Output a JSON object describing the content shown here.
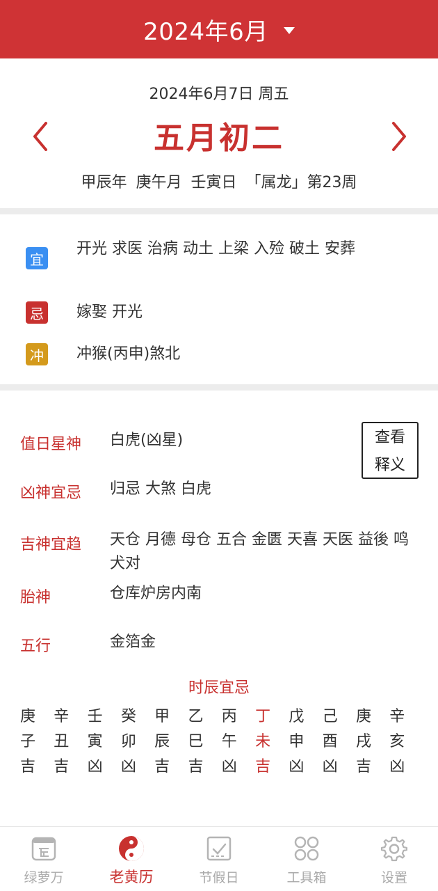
{
  "header": {
    "title": "2024年6月",
    "dropdown_icon": "caret-down-icon"
  },
  "date": {
    "solar": "2024年6月7日 周五",
    "lunar": "五月初二",
    "ganzhi": "甲辰年  庚午月  壬寅日  「属龙」第23周",
    "prev_icon": "chevron-left-icon",
    "next_icon": "chevron-right-icon"
  },
  "yiji": {
    "yi": {
      "badge": "宜",
      "color": "#3a8ff2",
      "text": "开光 求医 治病 动土 上梁 入殓 破土 安葬"
    },
    "ji": {
      "badge": "忌",
      "color": "#c8312f",
      "text": "嫁娶 开光"
    },
    "chong": {
      "badge": "冲",
      "color": "#d49a1c",
      "text": "冲猴(丙申)煞北"
    }
  },
  "details": {
    "explain_button": "查看释义",
    "rows": [
      {
        "label": "值日星神",
        "value": "白虎(凶星)"
      },
      {
        "label": "凶神宜忌",
        "value": "归忌 大煞 白虎"
      },
      {
        "label": "吉神宜趋",
        "value": "天仓 月德 母仓 五合 金匮 天喜 天医 益後 鸣犬对"
      },
      {
        "label": "胎神",
        "value": "仓库炉房内南"
      },
      {
        "label": "五行",
        "value": "金箔金"
      }
    ]
  },
  "hours": {
    "title": "时辰宜忌",
    "current_index": 7,
    "columns": [
      {
        "stem": "庚",
        "branch": "子",
        "luck": "吉"
      },
      {
        "stem": "辛",
        "branch": "丑",
        "luck": "吉"
      },
      {
        "stem": "壬",
        "branch": "寅",
        "luck": "凶"
      },
      {
        "stem": "癸",
        "branch": "卯",
        "luck": "凶"
      },
      {
        "stem": "甲",
        "branch": "辰",
        "luck": "吉"
      },
      {
        "stem": "乙",
        "branch": "巳",
        "luck": "吉"
      },
      {
        "stem": "丙",
        "branch": "午",
        "luck": "凶"
      },
      {
        "stem": "丁",
        "branch": "未",
        "luck": "吉"
      },
      {
        "stem": "戊",
        "branch": "申",
        "luck": "凶"
      },
      {
        "stem": "己",
        "branch": "酉",
        "luck": "凶"
      },
      {
        "stem": "庚",
        "branch": "戌",
        "luck": "吉"
      },
      {
        "stem": "辛",
        "branch": "亥",
        "luck": "凶"
      }
    ]
  },
  "tabs": [
    {
      "label": "绿萝万",
      "icon": "calendar-icon",
      "active": false
    },
    {
      "label": "老黄历",
      "icon": "yin-yang-icon",
      "active": true
    },
    {
      "label": "节假日",
      "icon": "checklist-icon",
      "active": false
    },
    {
      "label": "工具箱",
      "icon": "grid-icon",
      "active": false
    },
    {
      "label": "设置",
      "icon": "gear-icon",
      "active": false
    }
  ],
  "colors": {
    "brand": "#cf3335",
    "accent_text": "#c8312f",
    "inactive_tab": "#aaaaaa"
  }
}
